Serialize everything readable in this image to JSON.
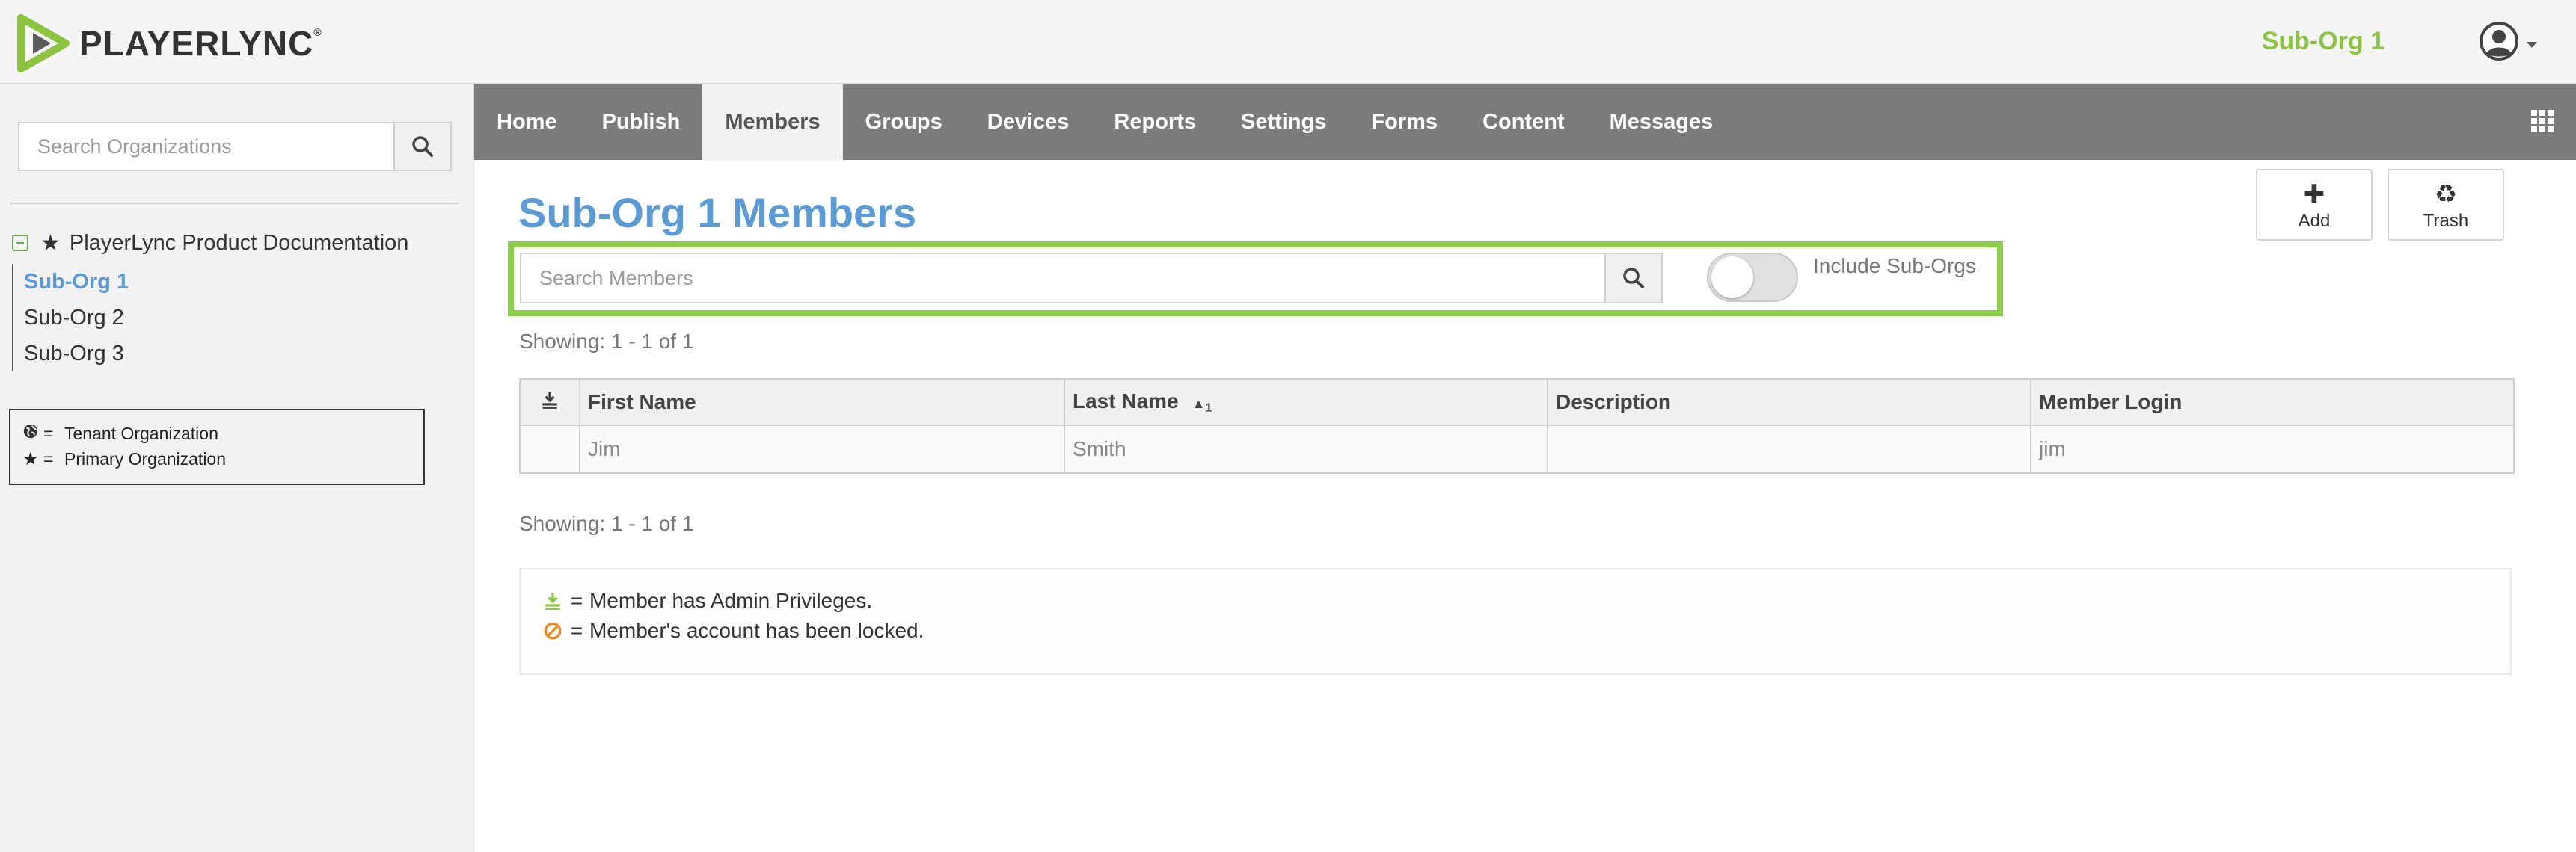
{
  "header": {
    "logo_text": "PLAYERLYNC",
    "logo_mark": "®",
    "org_name": "Sub-Org 1",
    "brand_color": "#8cc43f"
  },
  "sidebar": {
    "search_placeholder": "Search Organizations",
    "tree": {
      "root_label": "PlayerLync Product Documentation",
      "root_icon": "star-icon",
      "children": [
        {
          "label": "Sub-Org 1",
          "active": true
        },
        {
          "label": "Sub-Org 2",
          "active": false
        },
        {
          "label": "Sub-Org 3",
          "active": false
        }
      ]
    },
    "legend": [
      {
        "icon": "globe-icon",
        "eq": "=",
        "label": "Tenant Organization"
      },
      {
        "icon": "star-icon",
        "eq": "=",
        "label": "Primary Organization"
      }
    ]
  },
  "nav": {
    "items": [
      "Home",
      "Publish",
      "Members",
      "Groups",
      "Devices",
      "Reports",
      "Settings",
      "Forms",
      "Content",
      "Messages"
    ],
    "active": "Members"
  },
  "main": {
    "title": "Sub-Org 1 Members",
    "add_label": "Add",
    "trash_label": "Trash",
    "search_placeholder": "Search Members",
    "include_suborgs_label": "Include Sub-Orgs",
    "include_suborgs_on": false,
    "showing_top": "Showing: 1 - 1 of 1",
    "showing_bottom": "Showing: 1 - 1 of 1",
    "table": {
      "headers": [
        "First Name",
        "Last Name",
        "Description",
        "Member Login"
      ],
      "sort_subscript": "1",
      "rows": [
        {
          "first": "Jim",
          "last": "Smith",
          "description": "",
          "login": "jim"
        }
      ]
    },
    "info": [
      {
        "icon": "admin-icon",
        "eq": "=",
        "text": "Member has Admin Privileges."
      },
      {
        "icon": "locked-icon",
        "eq": "=",
        "text": "Member's account has been locked."
      }
    ]
  },
  "colors": {
    "title_blue": "#5b9bd5",
    "nav_gray": "#7b7b7b",
    "highlight_green": "#8ccf48",
    "locked_orange": "#f0891d"
  }
}
